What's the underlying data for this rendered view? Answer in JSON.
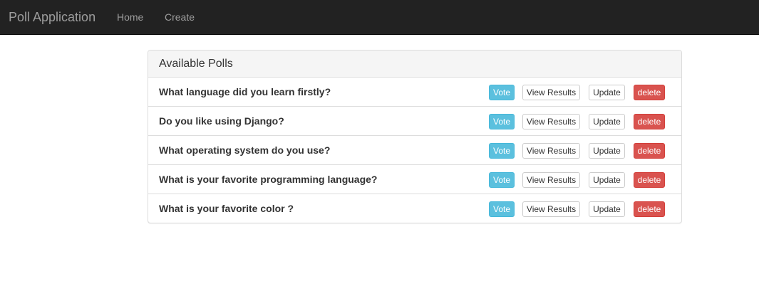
{
  "navbar": {
    "brand": "Poll Application",
    "links": [
      {
        "label": "Home"
      },
      {
        "label": "Create"
      }
    ]
  },
  "panel": {
    "title": "Available Polls",
    "polls": [
      {
        "question": "What language did you learn firstly?",
        "vote": "Vote",
        "results": "View Results",
        "update": "Update",
        "delete": "delete"
      },
      {
        "question": "Do you like using Django?",
        "vote": "Vote",
        "results": "View Results",
        "update": "Update",
        "delete": "delete"
      },
      {
        "question": "What operating system do you use?",
        "vote": "Vote",
        "results": "View Results",
        "update": "Update",
        "delete": "delete"
      },
      {
        "question": "What is your favorite programming language?",
        "vote": "Vote",
        "results": "View Results",
        "update": "Update",
        "delete": "delete"
      },
      {
        "question": "What is your favorite color ?",
        "vote": "Vote",
        "results": "View Results",
        "update": "Update",
        "delete": "delete"
      }
    ]
  },
  "colors": {
    "navbar_bg": "#222222",
    "nav_text": "#9d9d9d",
    "info": "#5bc0de",
    "danger": "#d9534f",
    "panel_heading_bg": "#f5f5f5"
  }
}
